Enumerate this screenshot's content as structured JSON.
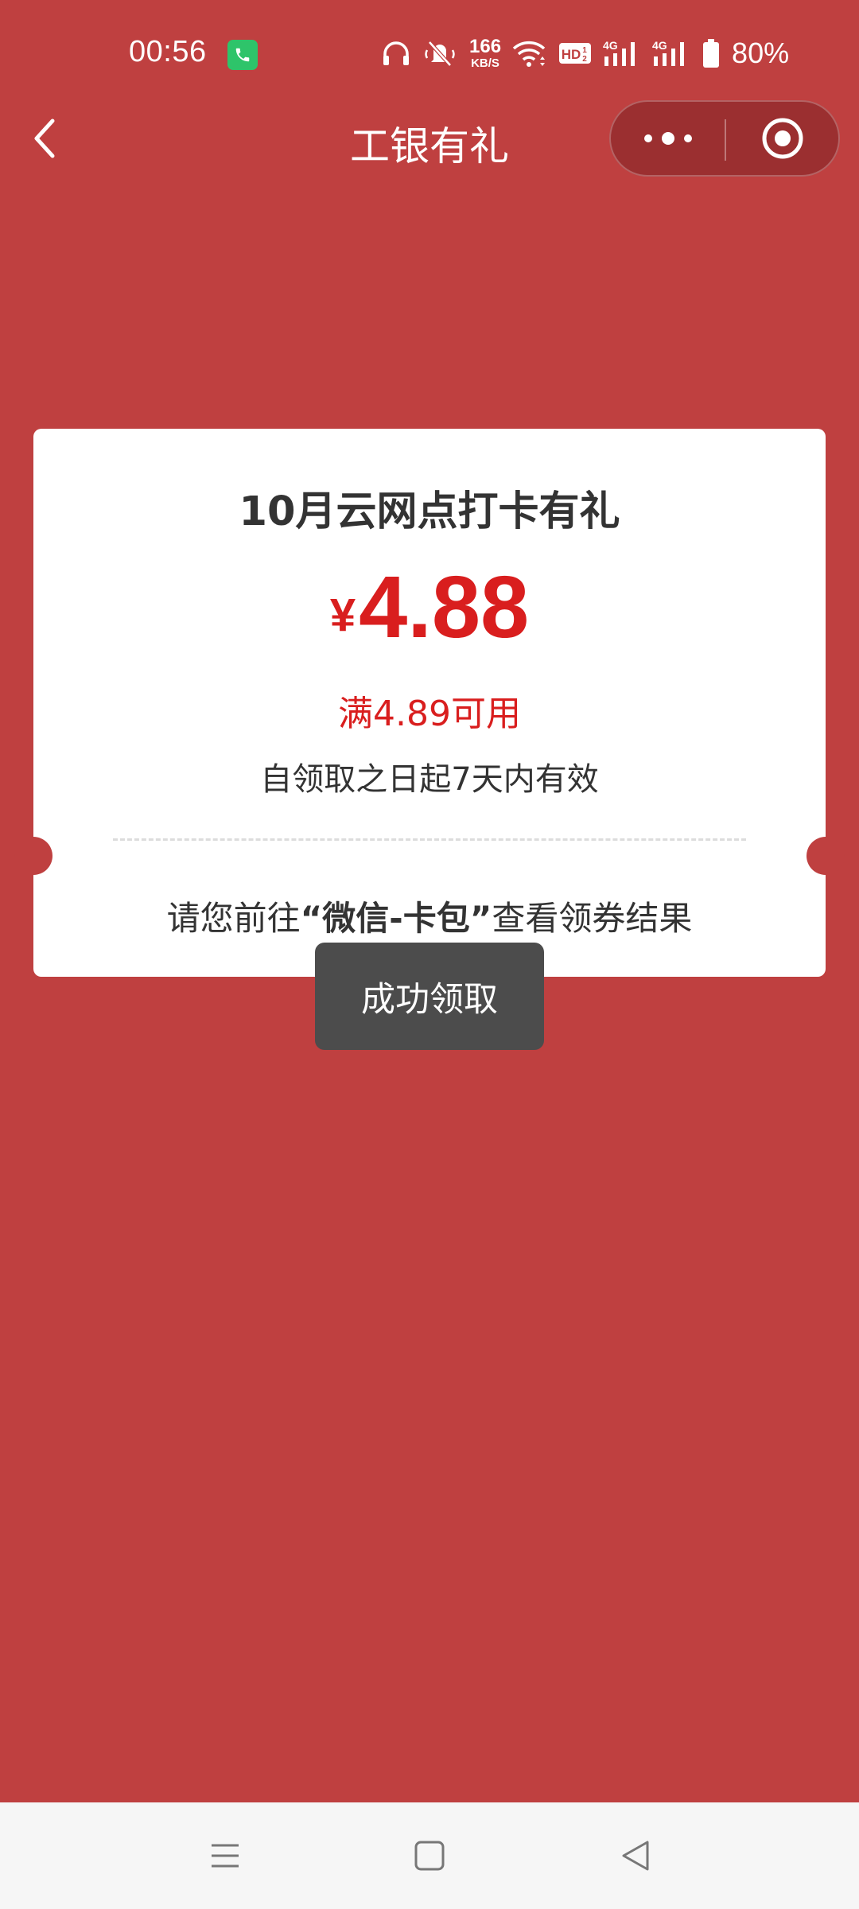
{
  "status_bar": {
    "time": "00:56",
    "net_speed_value": "166",
    "net_speed_unit": "KB/S",
    "battery_percent": "80%",
    "icons": [
      "phone-call-icon",
      "headphones-icon",
      "mute-icon",
      "wifi-icon",
      "hd-icon",
      "signal-4g-icon",
      "signal-4g-icon",
      "battery-icon"
    ]
  },
  "title_bar": {
    "title": "工银有礼"
  },
  "coupon": {
    "title": "10月云网点打卡有礼",
    "currency": "¥",
    "amount": "4.88",
    "condition": "满4.89可用",
    "validity": "自领取之日起7天内有效",
    "hint_prefix": "请您前往",
    "hint_highlight": "“微信-卡包”",
    "hint_suffix": "查看领券结果"
  },
  "toast": {
    "message": "成功领取"
  },
  "colors": {
    "background": "#bf4040",
    "accent_red": "#d91e1e",
    "capsule": "#9b2f30",
    "toast": "#4c4c4c"
  }
}
